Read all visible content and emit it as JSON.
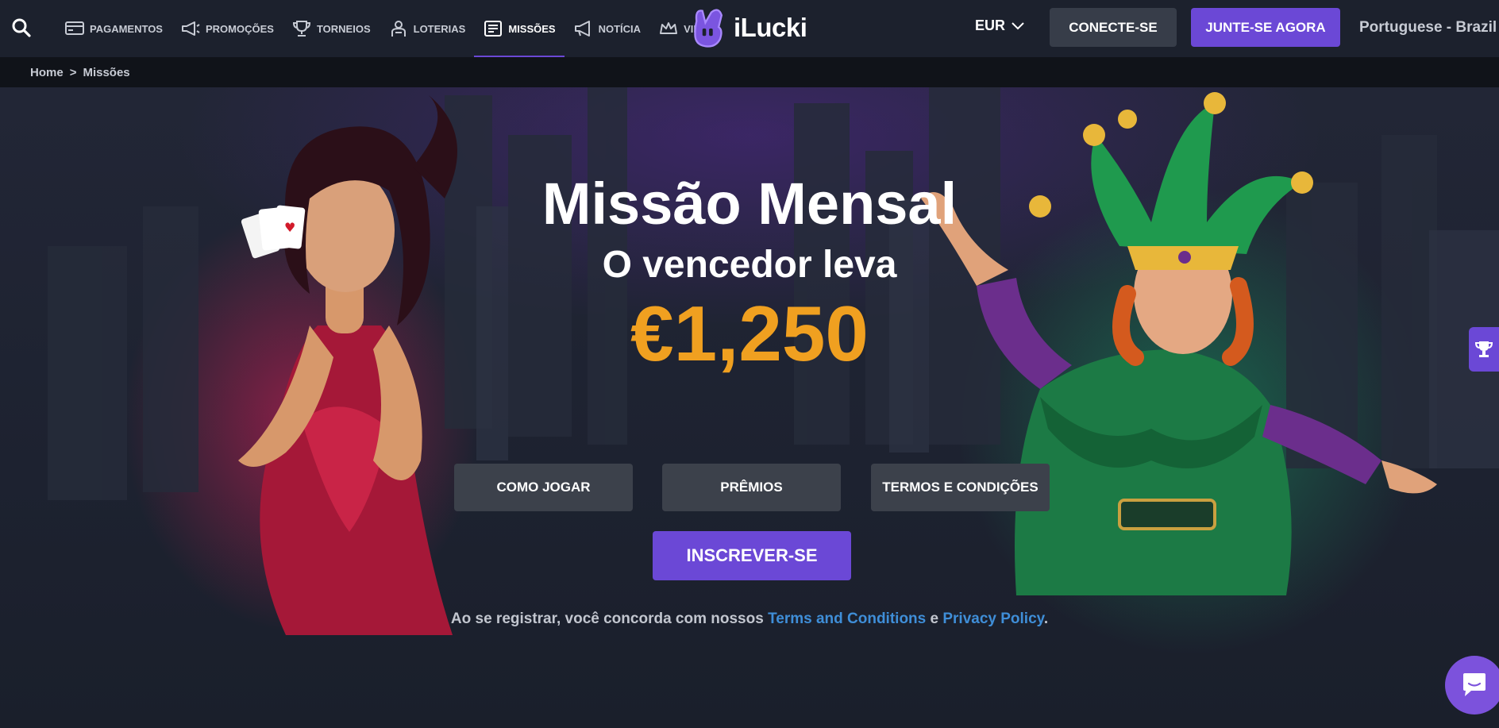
{
  "header": {
    "nav": [
      {
        "label": "PAGAMENTOS",
        "icon": "card-icon"
      },
      {
        "label": "PROMOÇÕES",
        "icon": "megaphone-icon"
      },
      {
        "label": "TORNEIOS",
        "icon": "trophy-icon"
      },
      {
        "label": "LOTERIAS",
        "icon": "lottery-icon"
      },
      {
        "label": "MISSÕES",
        "icon": "missions-icon",
        "active": true
      },
      {
        "label": "NOTÍCIA",
        "icon": "news-megaphone-icon"
      },
      {
        "label": "VIP",
        "icon": "crown-icon"
      }
    ],
    "logo_text": "iLucki",
    "currency": "EUR",
    "login_label": "CONECTE-SE",
    "join_label": "JUNTE-SE AGORA",
    "language": "Portuguese - Brazil"
  },
  "breadcrumb": {
    "home": "Home",
    "separator": ">",
    "current": "Missões"
  },
  "hero": {
    "title": "Missão Mensal",
    "subtitle": "O vencedor leva",
    "prize": "€1,250",
    "tabs": [
      "COMO JOGAR",
      "PRÊMIOS",
      "TERMOS E CONDIÇÕES"
    ],
    "signup_label": "INSCREVER-SE",
    "legal_prefix": "Ao se registrar, você concorda com nossos ",
    "legal_terms": "Terms and Conditions",
    "legal_and": " e ",
    "legal_privacy": "Privacy Policy",
    "legal_suffix": "."
  },
  "colors": {
    "accent": "#6b48d6",
    "prize": "#f0a020",
    "link": "#3f8ed8",
    "header_bg": "#1c212d"
  },
  "widgets": {
    "side_icon": "trophy-icon",
    "chat_icon": "chat-bubble-icon"
  }
}
